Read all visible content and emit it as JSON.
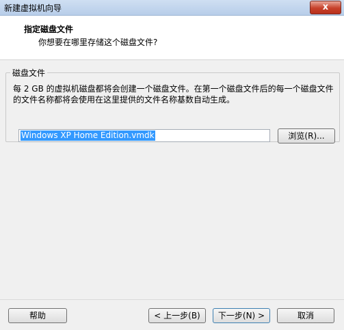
{
  "window": {
    "title": "新建虚拟机向导",
    "close_glyph": "x"
  },
  "header": {
    "title": "指定磁盘文件",
    "subtitle": "你想要在哪里存储这个磁盘文件?"
  },
  "disk_group": {
    "title": "磁盘文件",
    "description": "每 2 GB 的虚拟机磁盘都将会创建一个磁盘文件。在第一个磁盘文件后的每一个磁盘文件的文件名称都将会使用在这里提供的文件名称基数自动生成。",
    "filename_value": "Windows XP Home Edition.vmdk",
    "browse_label": "浏览(R)..."
  },
  "footer": {
    "help_label": "帮助",
    "back_label": "< 上一步(B)",
    "next_label": "下一步(N) >",
    "cancel_label": "取消"
  }
}
